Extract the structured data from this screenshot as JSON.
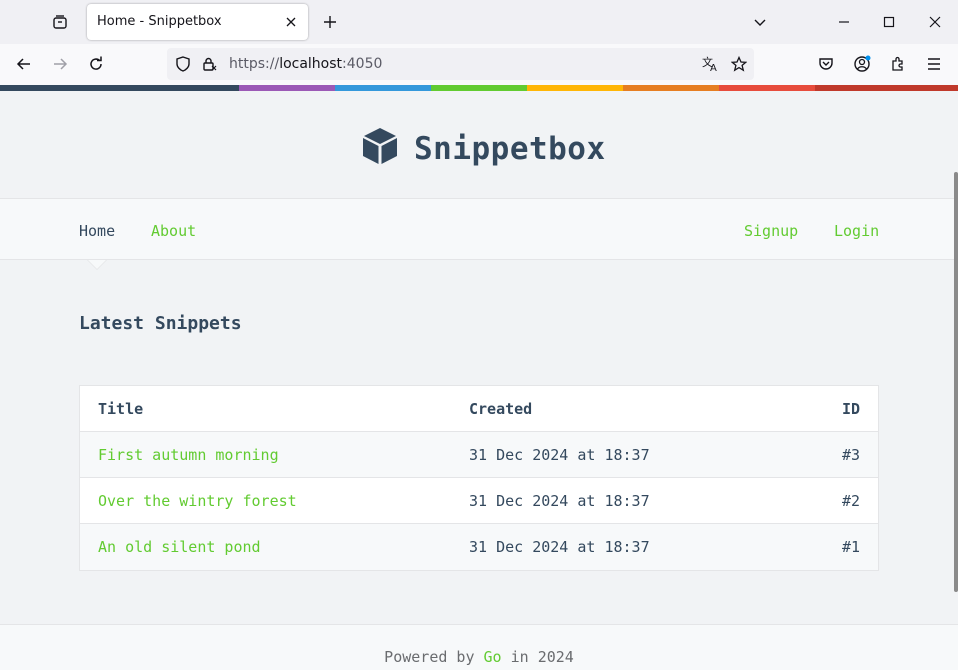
{
  "browser": {
    "tab_title": "Home - Snippetbox",
    "url_scheme": "https://",
    "url_host": "localhost",
    "url_port": ":4050"
  },
  "colors": {
    "accent": "#62cb31",
    "heading": "#34495e",
    "rainbow": [
      "#34495e",
      "#9b59b6",
      "#3498db",
      "#62cb31",
      "#ffb606",
      "#e67e22",
      "#e74c3c",
      "#c0392b"
    ]
  },
  "header": {
    "app_name": "Snippetbox",
    "logo_icon": "cube-icon"
  },
  "nav": {
    "home": "Home",
    "about": "About",
    "signup": "Signup",
    "login": "Login"
  },
  "main": {
    "heading": "Latest Snippets",
    "table": {
      "headers": {
        "title": "Title",
        "created": "Created",
        "id": "ID"
      },
      "rows": [
        {
          "title": "First autumn morning",
          "created": "31 Dec 2024 at 18:37",
          "id": "#3"
        },
        {
          "title": "Over the wintry forest",
          "created": "31 Dec 2024 at 18:37",
          "id": "#2"
        },
        {
          "title": "An old silent pond",
          "created": "31 Dec 2024 at 18:37",
          "id": "#1"
        }
      ]
    }
  },
  "footer": {
    "prefix": "Powered by ",
    "link": "Go",
    "suffix": " in 2024"
  }
}
